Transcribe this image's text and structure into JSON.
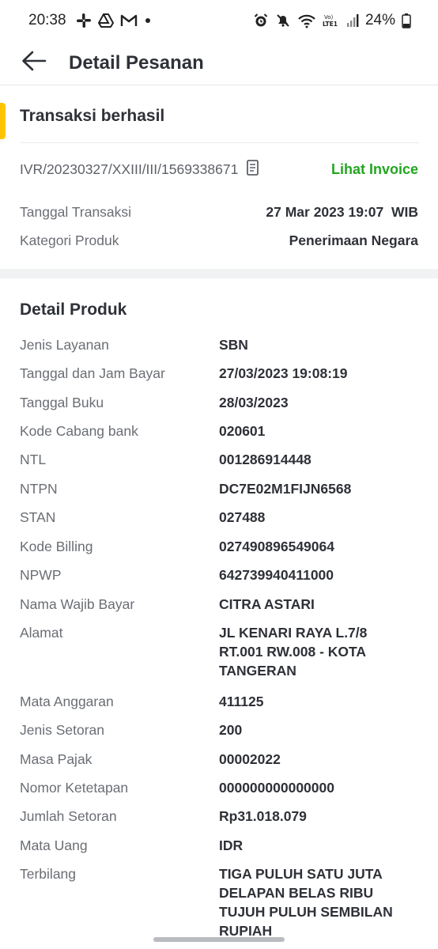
{
  "status_bar": {
    "time": "20:38",
    "battery": "24%",
    "network": "LTE1"
  },
  "header": {
    "title": "Detail Pesanan"
  },
  "transaction": {
    "status": "Transaksi berhasil",
    "reference": "IVR/20230327/XXIII/III/1569338671",
    "invoice_link": "Lihat Invoice",
    "rows": [
      {
        "label": "Tanggal Transaksi",
        "value": "27 Mar 2023 19:07  WIB"
      },
      {
        "label": "Kategori Produk",
        "value": "Penerimaan Negara"
      }
    ]
  },
  "detail": {
    "title": "Detail Produk",
    "rows": [
      {
        "label": "Jenis Layanan",
        "value": "SBN"
      },
      {
        "label": "Tanggal dan Jam Bayar",
        "value": "27/03/2023 19:08:19"
      },
      {
        "label": "Tanggal Buku",
        "value": "28/03/2023"
      },
      {
        "label": "Kode Cabang bank",
        "value": "020601"
      },
      {
        "label": "NTL",
        "value": "001286914448"
      },
      {
        "label": "NTPN",
        "value": "DC7E02M1FIJN6568"
      },
      {
        "label": "STAN",
        "value": "027488"
      },
      {
        "label": "Kode Billing",
        "value": "027490896549064"
      },
      {
        "label": "NPWP",
        "value": "642739940411000"
      },
      {
        "label": "Nama Wajib Bayar",
        "value": "CITRA ASTARI"
      },
      {
        "label": "Alamat",
        "value": "JL KENARI RAYA L.7/8 RT.001 RW.008 - KOTA TANGERAN"
      },
      {
        "label": "Mata Anggaran",
        "value": "411125"
      },
      {
        "label": "Jenis Setoran",
        "value": "200"
      },
      {
        "label": "Masa Pajak",
        "value": "00002022"
      },
      {
        "label": "Nomor Ketetapan",
        "value": "000000000000000"
      },
      {
        "label": "Jumlah Setoran",
        "value": "Rp31.018.079"
      },
      {
        "label": "Mata Uang",
        "value": "IDR"
      },
      {
        "label": "Terbilang",
        "value": "TIGA PULUH SATU JUTA DELAPAN BELAS RIBU TUJUH PULUH SEMBILAN RUPIAH"
      }
    ]
  },
  "colors": {
    "accent_yellow": "#ffc400",
    "link_green": "#22a61f",
    "text_dark": "#2e3137",
    "text_muted": "#6a6e74"
  }
}
